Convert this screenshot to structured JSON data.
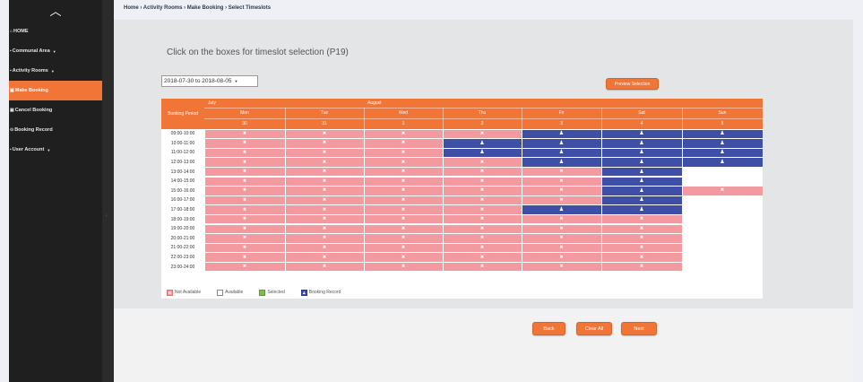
{
  "sidebar": {
    "toggle": "︿",
    "items": [
      {
        "icon": "⌂",
        "label": "HOME",
        "caret": "",
        "active": false
      },
      {
        "icon": "▪",
        "label": "Communal Area",
        "caret": "▼",
        "active": false
      },
      {
        "icon": "▪",
        "label": "Activity Rooms",
        "caret": "▼",
        "active": false
      },
      {
        "icon": "▣",
        "label": "Make Booking",
        "caret": "",
        "active": true
      },
      {
        "icon": "▣",
        "label": "Cancel Booking",
        "caret": "",
        "active": false
      },
      {
        "icon": "⊙",
        "label": "Booking Record",
        "caret": "",
        "active": false
      },
      {
        "icon": "▪",
        "label": "User Account",
        "caret": "▼",
        "active": false
      }
    ]
  },
  "breadcrumb": "Home › Activity Rooms › Make Booking › Select Timeslots",
  "instruction": "Click on the boxes for timeslot selection (P19)",
  "date_range": "2018-07-30 to 2018-08-05",
  "buttons": {
    "preview": "Preview Selection",
    "back": "Back",
    "clear_all": "Clear All",
    "next": "Next"
  },
  "calendar": {
    "period_header": "Booking Period",
    "months": [
      {
        "name": "July",
        "span": 2
      },
      {
        "name": "August",
        "span": 5
      }
    ],
    "days": [
      {
        "name": "Mon",
        "date": "30"
      },
      {
        "name": "Tue",
        "date": "31"
      },
      {
        "name": "Wed",
        "date": "1"
      },
      {
        "name": "Thu",
        "date": "2"
      },
      {
        "name": "Fri",
        "date": "3"
      },
      {
        "name": "Sat",
        "date": "4"
      },
      {
        "name": "Sun",
        "date": "5"
      }
    ],
    "slots": [
      "09:00-10:00",
      "10:00-11:00",
      "11:00-12:00",
      "12:00-13:00",
      "13:00-14:00",
      "14:00-15:00",
      "15:00-16:00",
      "16:00-17:00",
      "17:00-18:00",
      "18:00-19:00",
      "19:00-20:00",
      "20:00-21:00",
      "21:00-22:00",
      "22:00-23:00",
      "23:00-24:00"
    ],
    "status": [
      [
        "N",
        "N",
        "N",
        "N",
        "B",
        "B",
        "B"
      ],
      [
        "N",
        "N",
        "N",
        "B",
        "B",
        "B",
        "B"
      ],
      [
        "N",
        "N",
        "N",
        "B",
        "B",
        "B",
        "B"
      ],
      [
        "N",
        "N",
        "N",
        "N",
        "B",
        "B",
        "B"
      ],
      [
        "N",
        "N",
        "N",
        "N",
        "N",
        "B",
        "A"
      ],
      [
        "N",
        "N",
        "N",
        "N",
        "N",
        "B",
        "A"
      ],
      [
        "N",
        "N",
        "N",
        "N",
        "N",
        "B",
        "N"
      ],
      [
        "N",
        "N",
        "N",
        "N",
        "N",
        "B",
        "A"
      ],
      [
        "N",
        "N",
        "N",
        "N",
        "B",
        "B",
        "A"
      ],
      [
        "N",
        "N",
        "N",
        "N",
        "N",
        "N",
        "A"
      ],
      [
        "N",
        "N",
        "N",
        "N",
        "N",
        "N",
        "A"
      ],
      [
        "N",
        "N",
        "N",
        "N",
        "N",
        "N",
        "A"
      ],
      [
        "N",
        "N",
        "N",
        "N",
        "N",
        "N",
        "A"
      ],
      [
        "N",
        "N",
        "N",
        "N",
        "N",
        "N",
        "A"
      ],
      [
        "N",
        "N",
        "N",
        "N",
        "N",
        "N",
        "A"
      ]
    ]
  },
  "legend": {
    "not_available": "Not Available",
    "available": "Available",
    "selected": "Selected",
    "booking_record": "Booking Record"
  },
  "colors": {
    "accent": "#f07537",
    "not_available": "#f29aa0",
    "booked": "#3f4fa5",
    "selected": "#7ac142"
  },
  "icons": {
    "not_available": "close-icon",
    "booked": "person-icon"
  }
}
